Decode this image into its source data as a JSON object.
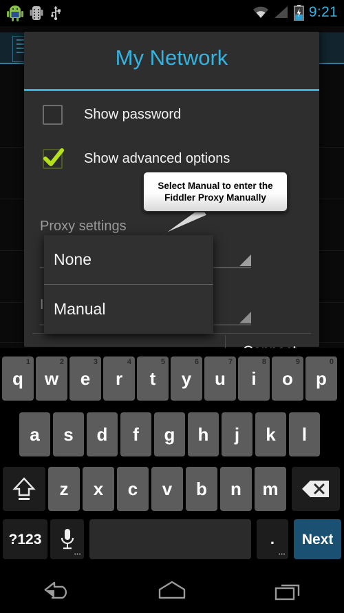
{
  "status_bar": {
    "time": "9:21",
    "icons": [
      "android-robot-icon",
      "android-debug-icon",
      "usb-icon",
      "wifi-icon",
      "cell-signal-icon",
      "battery-charging-icon"
    ]
  },
  "background_app": {
    "list_icon": "list-icon"
  },
  "dialog": {
    "title": "My Network",
    "accent_color": "#34b3e0",
    "checkboxes": [
      {
        "label": "Show password",
        "checked": false
      },
      {
        "label": "Show advanced options",
        "checked": true
      }
    ],
    "proxy": {
      "label": "Proxy settings",
      "selected": "None",
      "options": [
        "None",
        "Manual"
      ]
    },
    "ip_settings": {
      "label": "I"
    },
    "buttons": {
      "cancel": "",
      "connect": "Connect"
    }
  },
  "dropdown": {
    "items": [
      "None",
      "Manual"
    ]
  },
  "callout": {
    "line1": "Select Manual to enter the",
    "line2": "Fiddler Proxy Manually"
  },
  "keyboard": {
    "row1": [
      {
        "glyph": "q",
        "num": "1"
      },
      {
        "glyph": "w",
        "num": "2"
      },
      {
        "glyph": "e",
        "num": "3"
      },
      {
        "glyph": "r",
        "num": "4"
      },
      {
        "glyph": "t",
        "num": "5"
      },
      {
        "glyph": "y",
        "num": "6"
      },
      {
        "glyph": "u",
        "num": "7"
      },
      {
        "glyph": "i",
        "num": "8"
      },
      {
        "glyph": "o",
        "num": "9"
      },
      {
        "glyph": "p",
        "num": "0"
      }
    ],
    "row2": [
      {
        "glyph": "a"
      },
      {
        "glyph": "s"
      },
      {
        "glyph": "d"
      },
      {
        "glyph": "f"
      },
      {
        "glyph": "g"
      },
      {
        "glyph": "h"
      },
      {
        "glyph": "j"
      },
      {
        "glyph": "k"
      },
      {
        "glyph": "l"
      }
    ],
    "row3": [
      {
        "glyph": "z"
      },
      {
        "glyph": "x"
      },
      {
        "glyph": "c"
      },
      {
        "glyph": "v"
      },
      {
        "glyph": "b"
      },
      {
        "glyph": "n"
      },
      {
        "glyph": "m"
      }
    ],
    "shift_key": "shift-icon",
    "backspace_key": "backspace-icon",
    "symbols_key": "?123",
    "mic_key": "microphone-icon",
    "space_key": "",
    "period_key": ".",
    "action_key": "Next"
  },
  "navbar": {
    "back": "back-icon",
    "home": "home-icon",
    "recents": "recents-icon"
  }
}
